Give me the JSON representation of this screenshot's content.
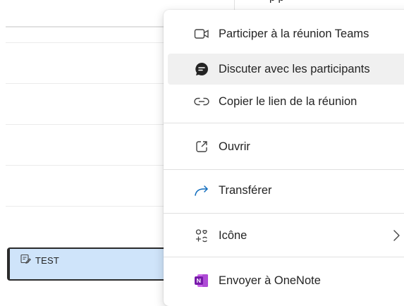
{
  "calendar": {
    "top_fragment": "p   p",
    "event": {
      "title": "TEST",
      "icon": "edit-note-icon"
    }
  },
  "menu": {
    "items": [
      {
        "label": "Participer à la réunion Teams",
        "icon": "video-camera-icon"
      },
      {
        "label": "Discuter avec les participants",
        "icon": "chat-icon"
      },
      {
        "label": "Copier le lien de la réunion",
        "icon": "link-icon"
      },
      {
        "label": "Ouvrir",
        "icon": "open-external-icon"
      },
      {
        "label": "Transférer",
        "icon": "forward-arrow-icon"
      },
      {
        "label": "Icône",
        "icon": "emoji-symbols-icon"
      },
      {
        "label": "Envoyer à OneNote",
        "icon": "onenote-icon"
      }
    ]
  },
  "colors": {
    "event_fill": "#cfe4fa",
    "forward_arrow": "#0f6cbd",
    "onenote": "#7719aa",
    "hover": "#f0f0f0"
  }
}
